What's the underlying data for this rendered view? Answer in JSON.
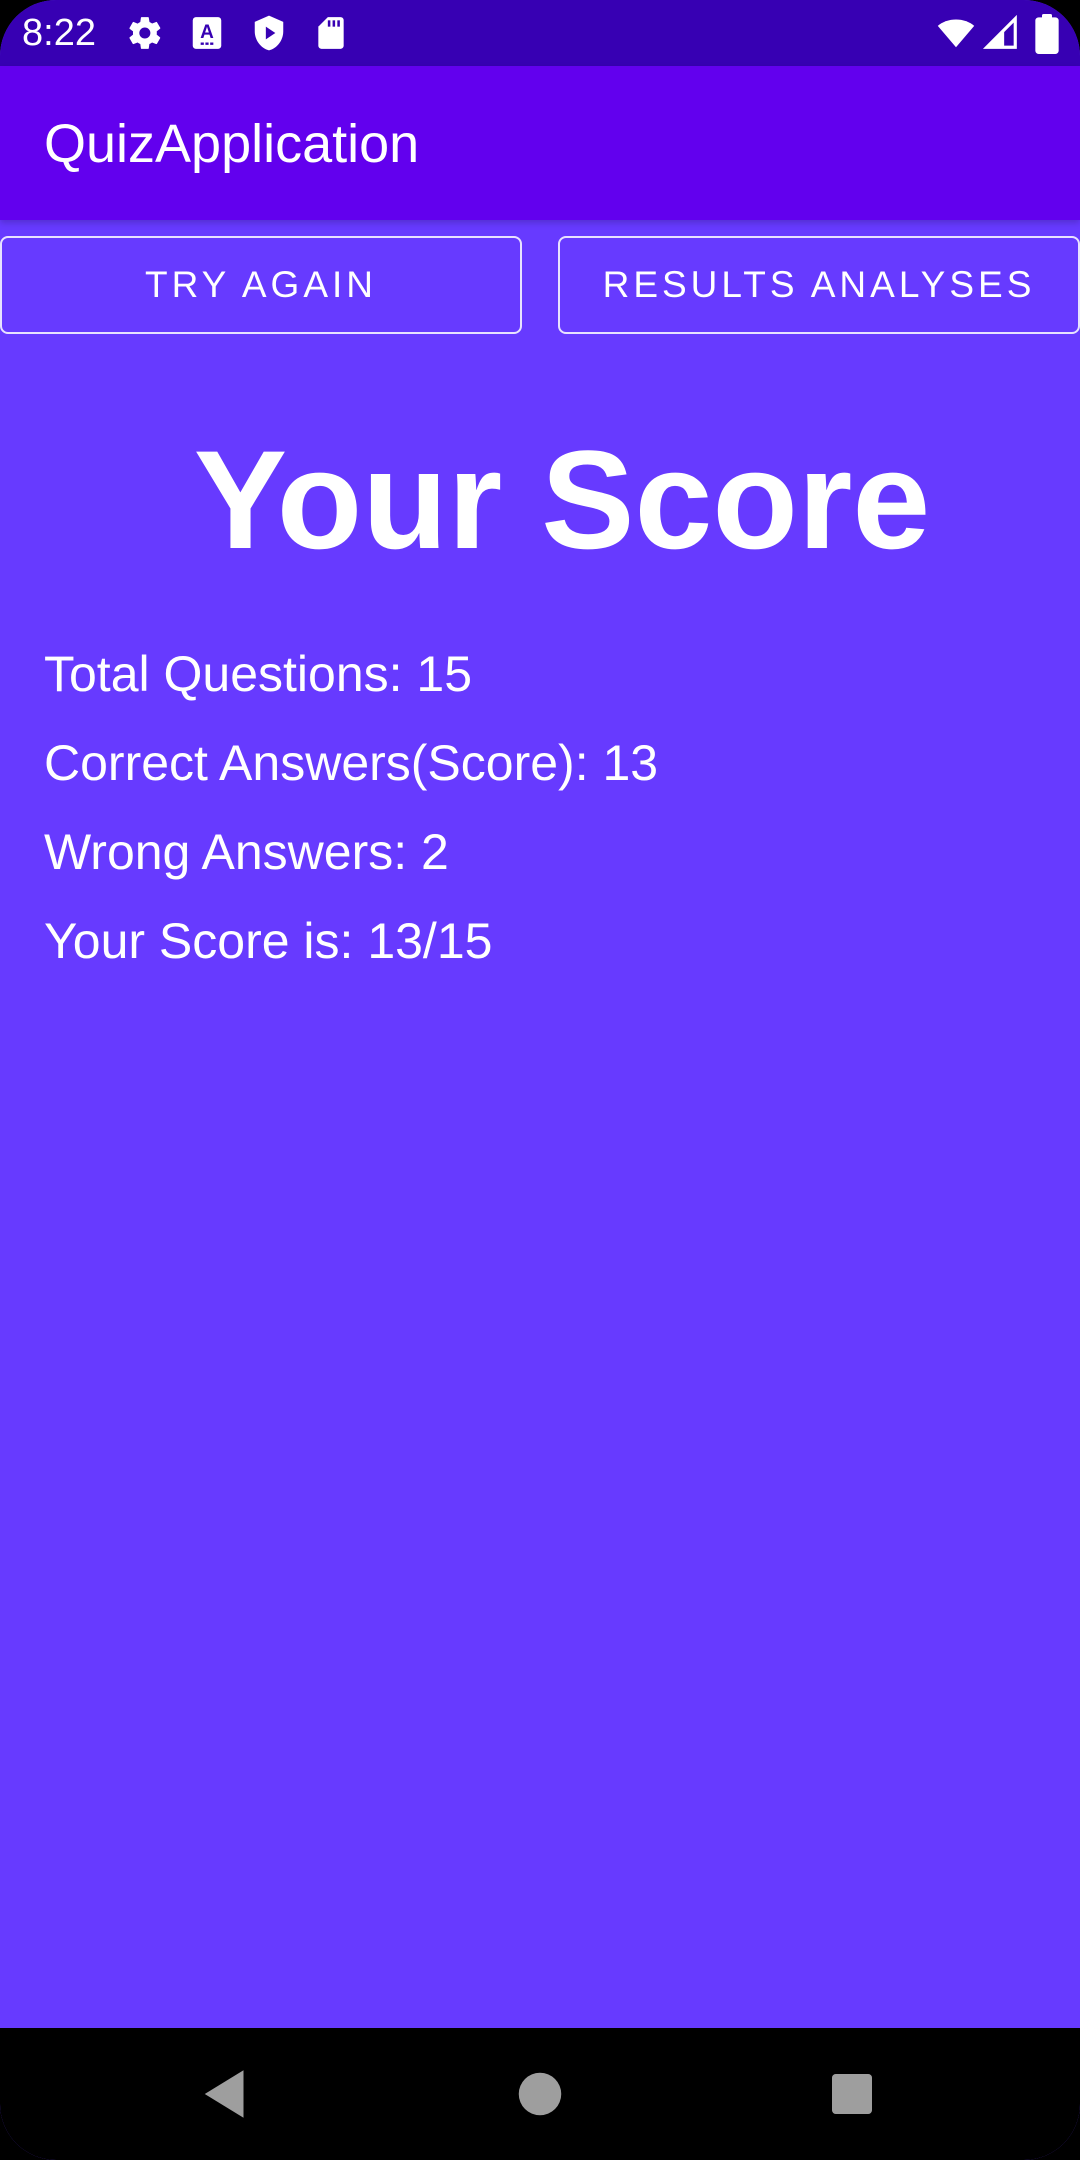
{
  "status_bar": {
    "time": "8:22",
    "icons": [
      "settings-icon",
      "accessibility-a-icon",
      "shield-play-icon",
      "sd-card-icon",
      "wifi-icon",
      "signal-icon",
      "battery-icon"
    ]
  },
  "app_bar": {
    "title": "QuizApplication"
  },
  "buttons": {
    "try_again": "TRY AGAIN",
    "results_analyses": "RESULTS ANALYSES"
  },
  "score": {
    "heading": "Your Score",
    "total_questions": "Total Questions: 15",
    "correct_answers": "Correct Answers(Score): 13",
    "wrong_answers": "Wrong Answers: 2",
    "score_line": "Your Score is: 13/15"
  },
  "nav_bar": {
    "icons": [
      "back-icon",
      "home-icon",
      "recents-icon"
    ]
  },
  "colors": {
    "status_bar": "#3700B3",
    "app_bar": "#6200EE",
    "background": "#673AFF",
    "text": "#FFFFFF"
  }
}
